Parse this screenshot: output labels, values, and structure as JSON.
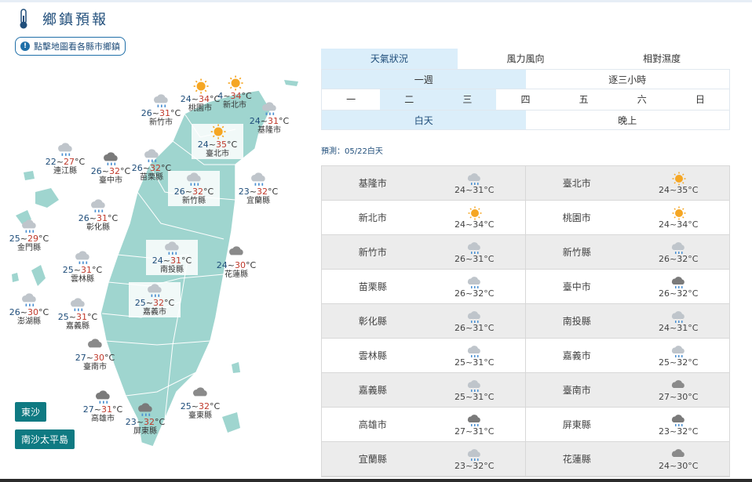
{
  "header": {
    "title": "鄉鎮預報",
    "map_hint": "點擊地圖看各縣市鄉鎮"
  },
  "colors": {
    "sea_land": "#9fd5cf",
    "accent": "#1f4d7a",
    "tab_active": "#dbeefa",
    "island_btn": "#0f7a82",
    "hi_temp": "#c0392b"
  },
  "map": {
    "stations": [
      {
        "name": "新竹市",
        "lo": "26",
        "hi": "31",
        "icon": "rain-cloud-icon"
      },
      {
        "name": "桃園市",
        "lo": "24",
        "hi": "34",
        "icon": "sun-icon"
      },
      {
        "name": "新北市",
        "lo": "4",
        "hi": "34",
        "icon": "sun-icon"
      },
      {
        "name": "基隆市",
        "lo": "24",
        "hi": "31",
        "icon": "rain-cloud-icon"
      },
      {
        "name": "臺北市",
        "lo": "24",
        "hi": "35",
        "icon": "sun-icon"
      },
      {
        "name": "連江縣",
        "lo": "22",
        "hi": "27",
        "icon": "rain-cloud-icon"
      },
      {
        "name": "臺中市",
        "lo": "26",
        "hi": "32",
        "icon": "dark-rain-cloud-icon"
      },
      {
        "name": "苗栗縣",
        "lo": "26",
        "hi": "32",
        "icon": "rain-cloud-icon"
      },
      {
        "name": "新竹縣",
        "lo": "26",
        "hi": "32",
        "icon": "rain-cloud-icon"
      },
      {
        "name": "宜蘭縣",
        "lo": "23",
        "hi": "32",
        "icon": "rain-cloud-icon"
      },
      {
        "name": "彰化縣",
        "lo": "26",
        "hi": "31",
        "icon": "rain-cloud-icon"
      },
      {
        "name": "金門縣",
        "lo": "25",
        "hi": "29",
        "icon": "rain-cloud-icon"
      },
      {
        "name": "南投縣",
        "lo": "24",
        "hi": "31",
        "icon": "rain-cloud-icon"
      },
      {
        "name": "花蓮縣",
        "lo": "24",
        "hi": "30",
        "icon": "cloud-icon"
      },
      {
        "name": "雲林縣",
        "lo": "25",
        "hi": "31",
        "icon": "rain-cloud-icon"
      },
      {
        "name": "嘉義市",
        "lo": "25",
        "hi": "32",
        "icon": "rain-cloud-icon"
      },
      {
        "name": "澎湖縣",
        "lo": "26",
        "hi": "30",
        "icon": "rain-cloud-icon"
      },
      {
        "name": "嘉義縣",
        "lo": "25",
        "hi": "31",
        "icon": "rain-cloud-icon"
      },
      {
        "name": "臺南市",
        "lo": "27",
        "hi": "30",
        "icon": "cloud-icon"
      },
      {
        "name": "高雄市",
        "lo": "27",
        "hi": "31",
        "icon": "dark-rain-cloud-icon"
      },
      {
        "name": "屏東縣",
        "lo": "23",
        "hi": "32",
        "icon": "dark-rain-cloud-icon"
      },
      {
        "name": "臺東縣",
        "lo": "25",
        "hi": "32",
        "icon": "cloud-icon"
      }
    ],
    "island_buttons": [
      "東沙",
      "南沙太平島"
    ]
  },
  "panel": {
    "tabs": [
      "天氣狀況",
      "風力風向",
      "相對濕度"
    ],
    "subtabs": [
      "一週",
      "逐三小時"
    ],
    "days": [
      "一",
      "二",
      "三",
      "四",
      "五",
      "六",
      "日"
    ],
    "day_night": [
      "白天",
      "晚上"
    ],
    "forecast_date": "預測：05/22白天",
    "rows": [
      [
        {
          "county": "基隆市",
          "temp": "24~31°C",
          "icon": "rain-cloud-icon"
        },
        {
          "county": "臺北市",
          "temp": "24~35°C",
          "icon": "sun-icon"
        }
      ],
      [
        {
          "county": "新北市",
          "temp": "24~34°C",
          "icon": "sun-icon"
        },
        {
          "county": "桃園市",
          "temp": "24~34°C",
          "icon": "sun-icon"
        }
      ],
      [
        {
          "county": "新竹市",
          "temp": "26~31°C",
          "icon": "rain-cloud-icon"
        },
        {
          "county": "新竹縣",
          "temp": "26~32°C",
          "icon": "rain-cloud-icon"
        }
      ],
      [
        {
          "county": "苗栗縣",
          "temp": "26~32°C",
          "icon": "rain-cloud-icon"
        },
        {
          "county": "臺中市",
          "temp": "26~32°C",
          "icon": "dark-rain-cloud-icon"
        }
      ],
      [
        {
          "county": "彰化縣",
          "temp": "26~31°C",
          "icon": "rain-cloud-icon"
        },
        {
          "county": "南投縣",
          "temp": "24~31°C",
          "icon": "rain-cloud-icon"
        }
      ],
      [
        {
          "county": "雲林縣",
          "temp": "25~31°C",
          "icon": "rain-cloud-icon"
        },
        {
          "county": "嘉義市",
          "temp": "25~32°C",
          "icon": "rain-cloud-icon"
        }
      ],
      [
        {
          "county": "嘉義縣",
          "temp": "25~31°C",
          "icon": "rain-cloud-icon"
        },
        {
          "county": "臺南市",
          "temp": "27~30°C",
          "icon": "cloud-icon"
        }
      ],
      [
        {
          "county": "高雄市",
          "temp": "27~31°C",
          "icon": "dark-rain-cloud-icon"
        },
        {
          "county": "屏東縣",
          "temp": "23~32°C",
          "icon": "dark-rain-cloud-icon"
        }
      ],
      [
        {
          "county": "宜蘭縣",
          "temp": "23~32°C",
          "icon": "rain-cloud-icon"
        },
        {
          "county": "花蓮縣",
          "temp": "24~30°C",
          "icon": "cloud-icon"
        }
      ]
    ]
  }
}
